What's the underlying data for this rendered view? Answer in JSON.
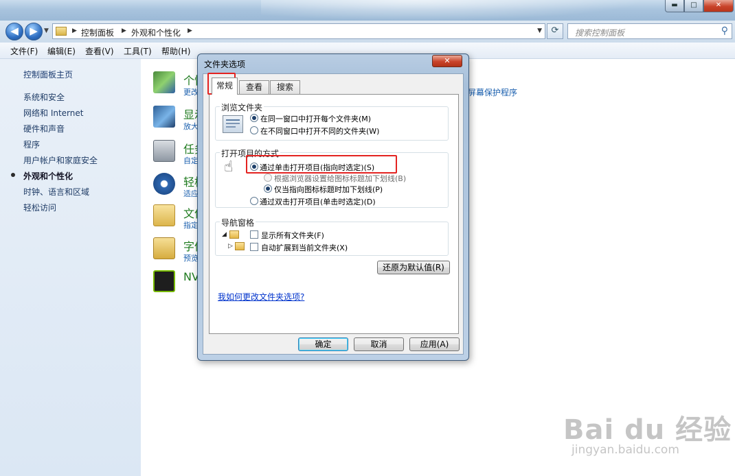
{
  "window": {
    "breadcrumb": [
      "控制面板",
      "外观和个性化"
    ],
    "search_placeholder": "搜索控制面板",
    "controls": {
      "minimize": "▬",
      "maximize": "□",
      "close": "✕"
    }
  },
  "menu": [
    "文件(F)",
    "编辑(E)",
    "查看(V)",
    "工具(T)",
    "帮助(H)"
  ],
  "sidebar": {
    "items": [
      "控制面板主页",
      "系统和安全",
      "网络和 Internet",
      "硬件和声音",
      "程序",
      "用户帐户和家庭安全",
      "外观和个性化",
      "时钟、语言和区域",
      "轻松访问"
    ],
    "active_index": 6
  },
  "main": {
    "categories": [
      {
        "title": "个性",
        "sub": "更改"
      },
      {
        "title": "显示",
        "sub": "放大"
      },
      {
        "title": "任务",
        "sub": "自定"
      },
      {
        "title": "轻松",
        "sub": "适应"
      },
      {
        "title": "文件",
        "sub": "指定"
      },
      {
        "title": "字体",
        "sub": "预览"
      },
      {
        "title": "NV",
        "sub": ""
      }
    ],
    "extra_link": "屏幕保护程序"
  },
  "dialog": {
    "title": "文件夹选项",
    "close": "✕",
    "tabs": [
      "常规",
      "查看",
      "搜索"
    ],
    "selected_tab": 0,
    "browse_group": {
      "label": "浏览文件夹",
      "options": [
        "在同一窗口中打开每个文件夹(M)",
        "在不同窗口中打开不同的文件夹(W)"
      ],
      "selected": 0
    },
    "open_group": {
      "label": "打开项目的方式",
      "options": [
        "通过单击打开项目(指向时选定)(S)",
        "根据浏览器设置给图标标题加下划线(B)",
        "仅当指向图标标题时加下划线(P)",
        "通过双击打开项目(单击时选定)(D)"
      ],
      "selected": 0,
      "underline_selected": 2
    },
    "nav_group": {
      "label": "导航窗格",
      "options": [
        "显示所有文件夹(F)",
        "自动扩展到当前文件夹(X)"
      ],
      "checked": [
        false,
        false
      ]
    },
    "restore_button": "还原为默认值(R)",
    "help_link": "我如何更改文件夹选项?",
    "ok": "确定",
    "cancel": "取消",
    "apply": "应用(A)"
  },
  "watermark": {
    "brand": "Bai du 经验",
    "url": "jingyan.baidu.com"
  },
  "colors": {
    "highlight_red": "#e32220",
    "link_blue": "#1a5fae",
    "category_green": "#1e7a1e"
  }
}
